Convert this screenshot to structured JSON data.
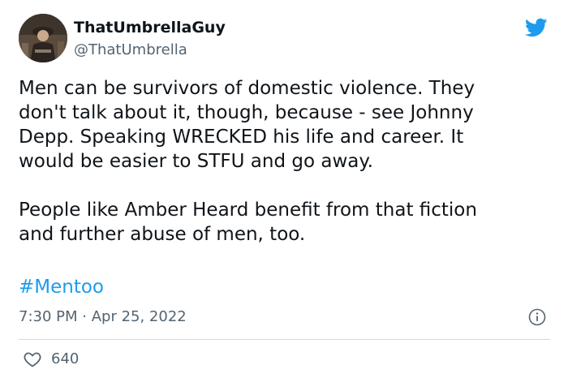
{
  "author": {
    "display_name": "ThatUmbrellaGuy",
    "handle": "@ThatUmbrella"
  },
  "tweet": {
    "text": "Men can be survivors of domestic violence. They\ndon't talk about it, though, because - see Johnny\nDepp. Speaking WRECKED his life and career. It\nwould be easier to STFU and go away.\n\nPeople like Amber Heard benefit from that fiction\nand further abuse of men, too.",
    "hashtag": "#Mentoo",
    "time": "7:30 PM",
    "separator": " · ",
    "date": "Apr 25, 2022",
    "like_count": "640"
  },
  "icons": {
    "brand": "twitter-bird-icon",
    "info": "info-icon",
    "like": "heart-icon"
  },
  "colors": {
    "brand": "#1d9bf0",
    "text": "#0f1419",
    "secondary": "#536471",
    "divider": "#cfd9de"
  }
}
